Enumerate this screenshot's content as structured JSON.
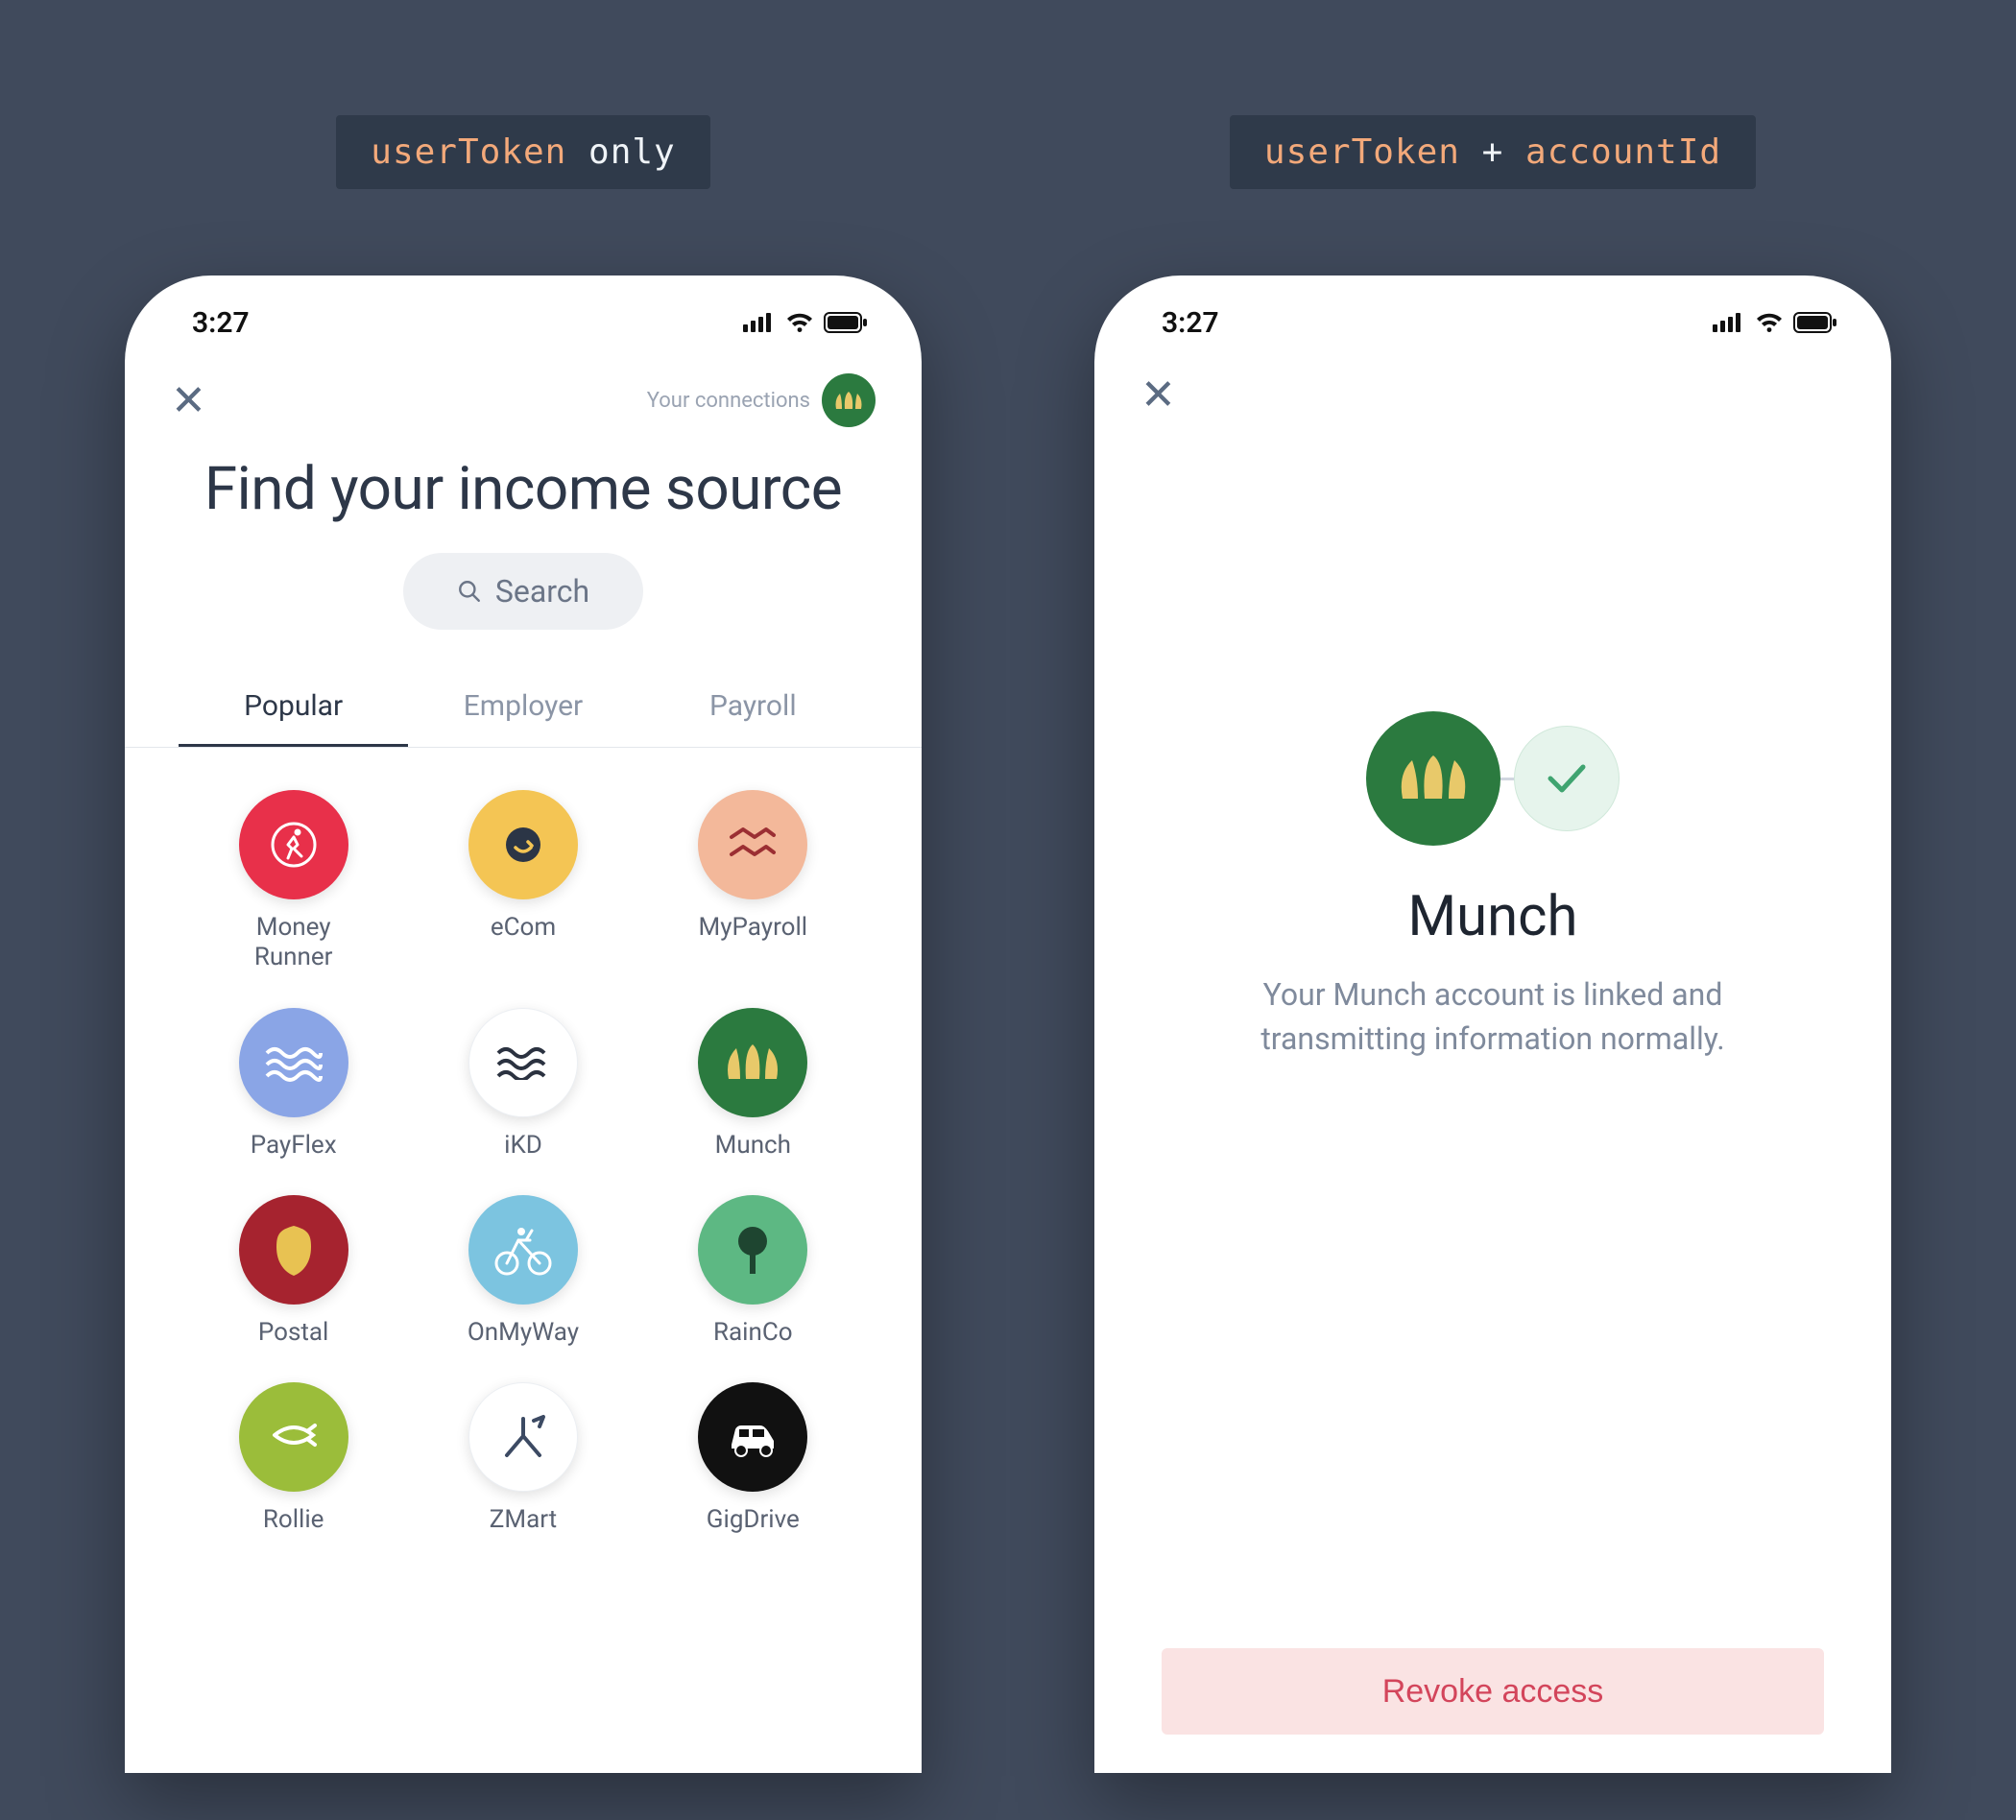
{
  "labels": {
    "left_tok": "userToken",
    "left_txt": " only",
    "right_tok1": "userToken",
    "right_plus": " + ",
    "right_tok2": "accountId"
  },
  "status": {
    "time": "3:27"
  },
  "left": {
    "connections_label": "Your connections",
    "title": "Find your income source",
    "search_placeholder": "Search",
    "tabs": [
      "Popular",
      "Employer",
      "Payroll"
    ],
    "items": [
      {
        "label": "Money Runner"
      },
      {
        "label": "eCom"
      },
      {
        "label": "MyPayroll"
      },
      {
        "label": "PayFlex"
      },
      {
        "label": "iKD"
      },
      {
        "label": "Munch"
      },
      {
        "label": "Postal"
      },
      {
        "label": "OnMyWay"
      },
      {
        "label": "RainCo"
      },
      {
        "label": "Rollie"
      },
      {
        "label": "ZMart"
      },
      {
        "label": "GigDrive"
      }
    ]
  },
  "right": {
    "title": "Munch",
    "description": "Your Munch account is linked and transmitting information normally.",
    "revoke_label": "Revoke access"
  }
}
